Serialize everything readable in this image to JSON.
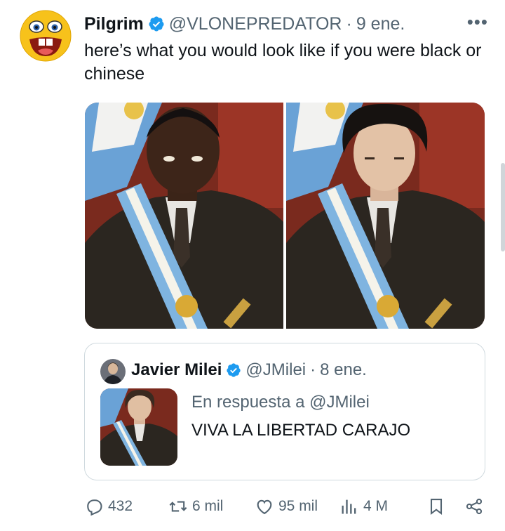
{
  "tweet": {
    "author_name": "Pilgrim",
    "handle": "@VLONEPREDATOR",
    "separator": "·",
    "date": "9 ene.",
    "more": "•••",
    "text": "here’s what you would look like if you were black or chinese",
    "avatar_icon": "laughing-emoji-icon",
    "verified_icon": "verified-badge-icon",
    "accent_color": "#1d9bf0"
  },
  "media": {
    "images": [
      {
        "name": "photo-left"
      },
      {
        "name": "photo-right"
      }
    ]
  },
  "quote": {
    "author_name": "Javier Milei",
    "handle": "@JMilei",
    "separator": "·",
    "date": "8 ene.",
    "reply_to": "En respuesta a @JMilei",
    "text": "VIVA LA LIBERTAD CARAJO"
  },
  "actions": {
    "replies": "432",
    "retweets": "6 mil",
    "likes": "95 mil",
    "views": "4 M",
    "icons": [
      "reply-icon",
      "retweet-icon",
      "like-icon",
      "views-icon",
      "bookmark-icon",
      "share-icon"
    ]
  }
}
